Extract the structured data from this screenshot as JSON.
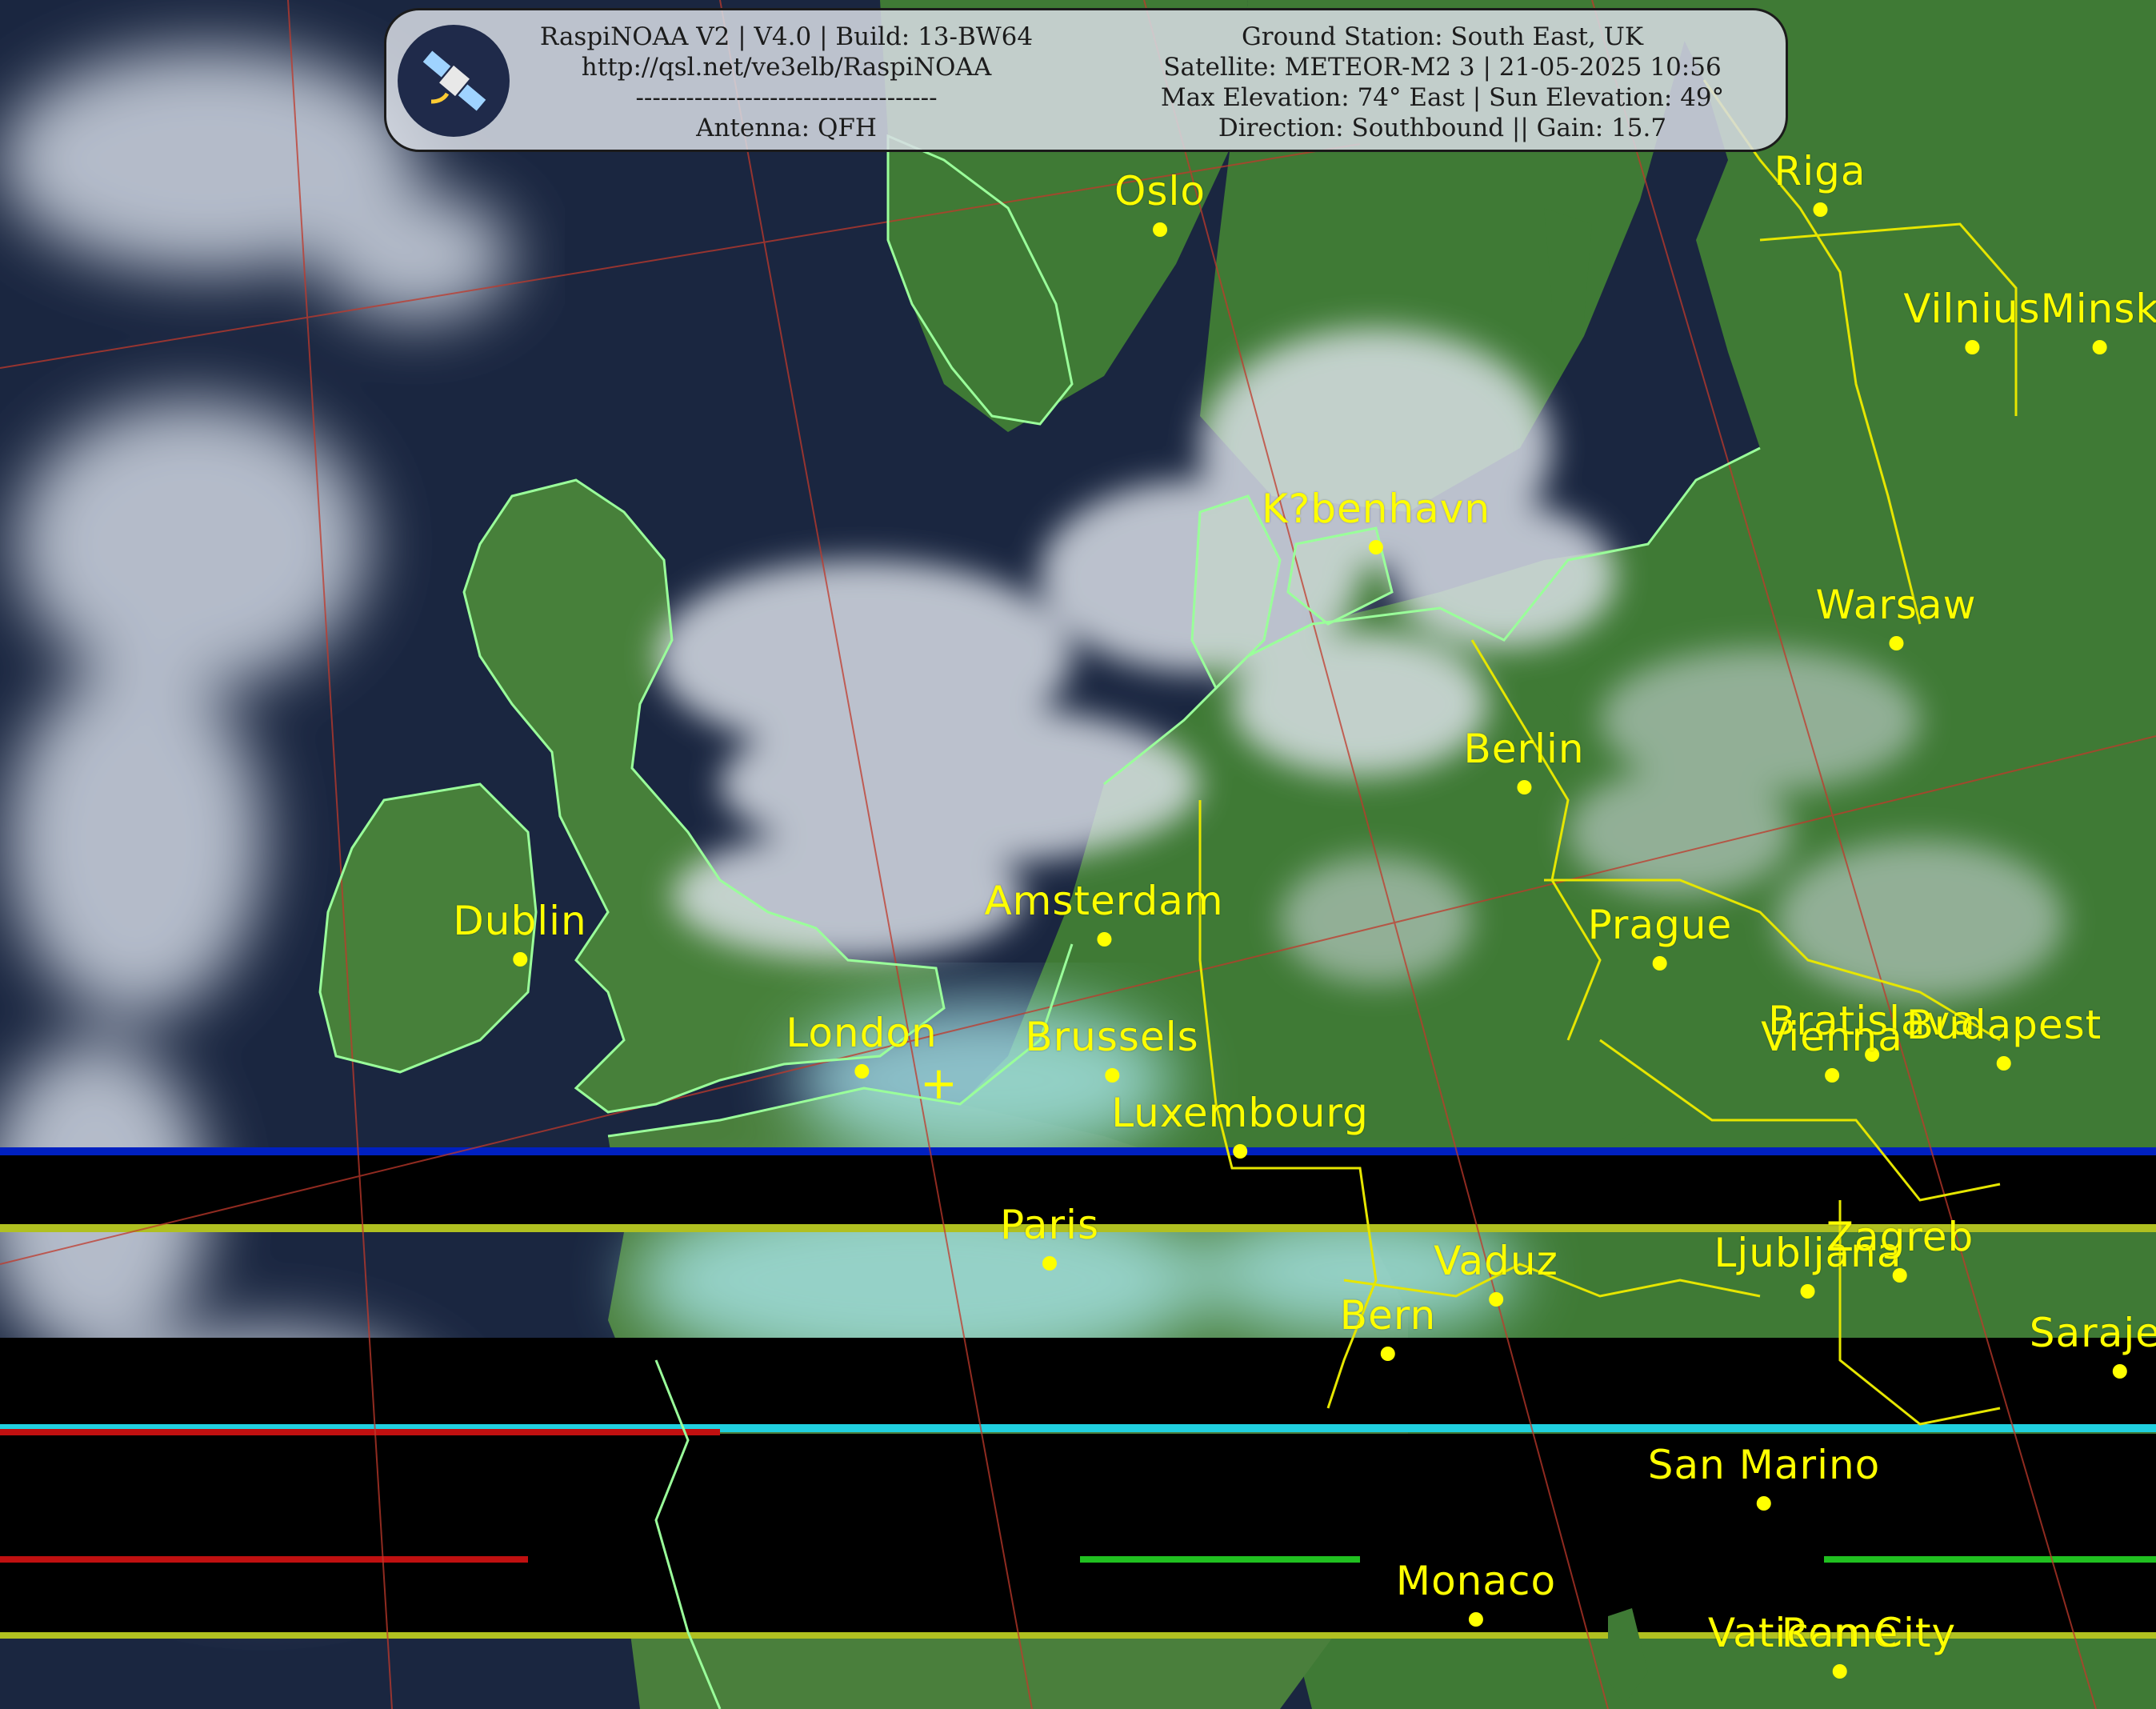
{
  "banner": {
    "software": "RaspiNOAA V2 | V4.0 | Build: 13-BW64",
    "url": "http://qsl.net/ve3elb/RaspiNOAA",
    "separator": "------------------------------------",
    "antenna": "Antenna: QFH",
    "ground_station": "Ground Station: South East, UK",
    "satellite": "Satellite: METEOR-M2 3 | 21-05-2025 10:56",
    "elevation": "Max Elevation: 74° East | Sun Elevation: 49°",
    "direction": "Direction: Southbound || Gain: 15.7",
    "logo_icon": "satellite-icon"
  },
  "cities": [
    {
      "name": "Oslo"
    },
    {
      "name": "Riga"
    },
    {
      "name": "Vilnius"
    },
    {
      "name": "Minsk"
    },
    {
      "name": "K?benhavn"
    },
    {
      "name": "Warsaw"
    },
    {
      "name": "Berlin"
    },
    {
      "name": "Dublin"
    },
    {
      "name": "Amsterdam"
    },
    {
      "name": "Prague"
    },
    {
      "name": "London"
    },
    {
      "name": "Brussels"
    },
    {
      "name": "Bratislava"
    },
    {
      "name": "Budapest"
    },
    {
      "name": "Vienna"
    },
    {
      "name": "Luxembourg"
    },
    {
      "name": "Paris"
    },
    {
      "name": "Vaduz"
    },
    {
      "name": "Ljubljana"
    },
    {
      "name": "Zagreb"
    },
    {
      "name": "Bern"
    },
    {
      "name": "Sarajevo"
    },
    {
      "name": "San Marino"
    },
    {
      "name": "Monaco"
    },
    {
      "name": "Rome"
    },
    {
      "name": "Vatican City"
    }
  ],
  "colors": {
    "label": "#ffff00",
    "sea": "#1a2640",
    "land": "#3f7a35",
    "cloud": "#d8dde6",
    "haze": "#a8e6ea",
    "coastline": "#9aff9a",
    "border": "#e6e600",
    "grid": "#c0392b"
  }
}
